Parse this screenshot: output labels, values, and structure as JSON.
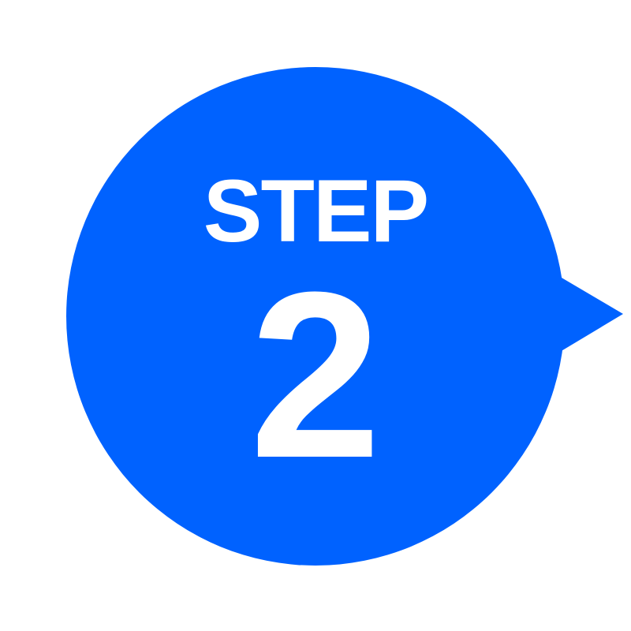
{
  "badge": {
    "label": "STEP",
    "number": "2",
    "fill_color": "#0062FF",
    "text_color": "#FFFFFF",
    "shape": "speech-bubble-circle-pointing-right"
  }
}
